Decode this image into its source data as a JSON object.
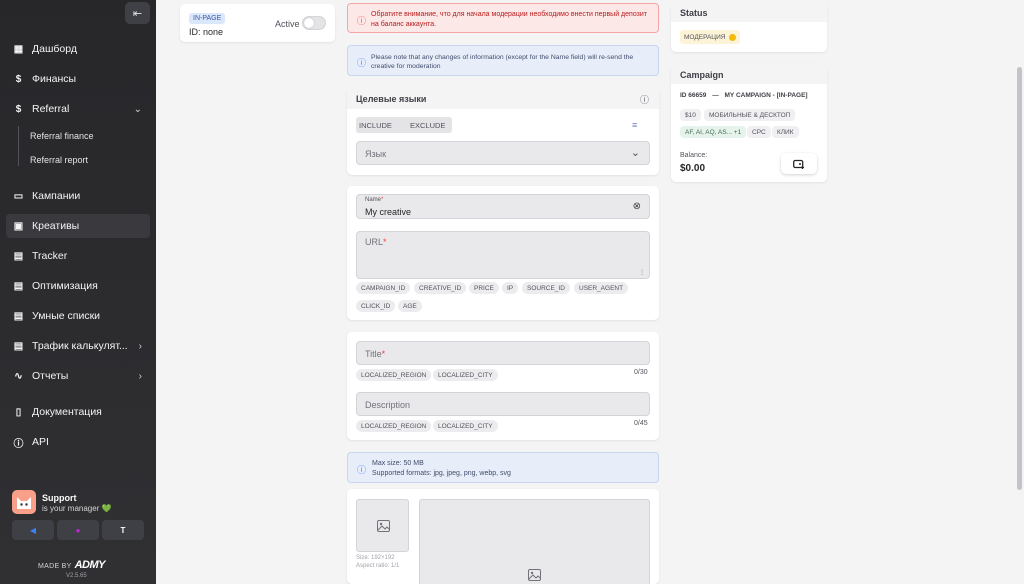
{
  "sidebar": {
    "collapse_glyph": "⇤",
    "items": [
      {
        "label": "Дашборд",
        "icon": "dashboard-icon",
        "glyph": "▦"
      },
      {
        "label": "Финансы",
        "icon": "dollar-icon",
        "glyph": "$"
      },
      {
        "label": "Referral",
        "icon": "dollar-icon",
        "glyph": "$"
      },
      {
        "label": "Кампании",
        "icon": "monitor-icon",
        "glyph": "▭"
      },
      {
        "label": "Креативы",
        "icon": "image-icon",
        "glyph": "▣"
      },
      {
        "label": "Tracker",
        "icon": "document-icon",
        "glyph": "▤"
      },
      {
        "label": "Оптимизация",
        "icon": "document-icon",
        "glyph": "▤"
      },
      {
        "label": "Умные списки",
        "icon": "document-icon",
        "glyph": "▤"
      },
      {
        "label": "Трафик калькулят...",
        "icon": "calculator-icon",
        "glyph": "▤"
      },
      {
        "label": "Отчеты",
        "icon": "activity-icon",
        "glyph": "∿"
      },
      {
        "label": "Документация",
        "icon": "book-icon",
        "glyph": "▯"
      },
      {
        "label": "API",
        "icon": "info-icon",
        "glyph": "ⓘ"
      }
    ],
    "sub_items": [
      "Referral finance",
      "Referral report"
    ],
    "support_title": "Support",
    "support_sub": "is your manager 💚",
    "made_by": "MADE BY",
    "brand": "ADMY",
    "version": "V2.5.65"
  },
  "creative_card": {
    "format_badge": "IN-PAGE",
    "id_text": "ID: none",
    "active_label": "Active"
  },
  "alerts": {
    "deposit": "Обратите внимание, что для начала модерации необходимо внести первый депозит на баланс аккаунта.",
    "resend": "Please note that any changes of information (except for the Name field) will re-send the creative for moderation",
    "upload_max": "Max size: 50 MB",
    "upload_formats": "Supported formats: jpg, jpeg, png, webp, svg"
  },
  "languages": {
    "title": "Целевые языки",
    "include": "INCLUDE",
    "exclude": "EXCLUDE",
    "select_placeholder": "Язык"
  },
  "form": {
    "name_label": "Name",
    "name_value": "My creative",
    "url_label": "URL",
    "url_macros": [
      "CAMPAIGN_ID",
      "CREATIVE_ID",
      "PRICE",
      "IP",
      "SOURCE_ID",
      "USER_AGENT",
      "CLICK_ID",
      "AGE"
    ],
    "title_label": "Title",
    "title_macros": [
      "LOCALIZED_REGION",
      "LOCALIZED_CITY"
    ],
    "title_counter": "0/30",
    "desc_placeholder": "Description",
    "desc_macros": [
      "LOCALIZED_REGION",
      "LOCALIZED_CITY"
    ],
    "desc_counter": "0/45",
    "image_size": "Size: 192×192",
    "image_ratio": "Aspect ratio: 1/1"
  },
  "status": {
    "title": "Status",
    "badge": "МОДЕРАЦИЯ"
  },
  "campaign": {
    "title": "Campaign",
    "id_line": "ID 66659",
    "dash": "—",
    "name": "MY CAMPAIGN - [IN-PAGE]",
    "tags": [
      "$10",
      "МОБИЛЬНЫЕ & ДЕСКТОП",
      "AF, AI, AQ, AS... +1",
      "CPC",
      "КЛИК"
    ],
    "balance_label": "Balance:",
    "balance_value": "$0.00"
  },
  "colors": {
    "sidebar_bg": "#27272a",
    "alert_red_bg": "#fde8e8",
    "alert_blue_bg": "#e8eef9",
    "moderation_badge": "#fdf3d7",
    "in_page_badge": "#dbe7fb"
  }
}
